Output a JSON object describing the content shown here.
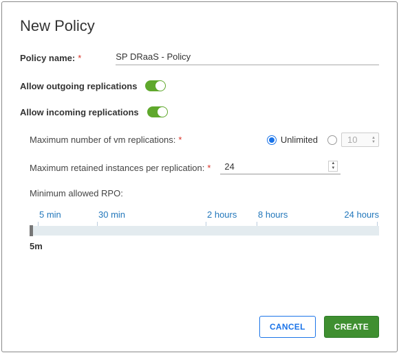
{
  "title": "New Policy",
  "policyName": {
    "label": "Policy name:",
    "required": "*",
    "value": "SP DRaaS - Policy"
  },
  "toggles": {
    "outgoing": {
      "label": "Allow outgoing replications",
      "on": true
    },
    "incoming": {
      "label": "Allow incoming replications",
      "on": true
    }
  },
  "maxVm": {
    "label": "Maximum number of vm replications:",
    "required": "*",
    "options": {
      "unlimited": "Unlimited",
      "custom": "10"
    }
  },
  "maxInstances": {
    "label": "Maximum retained instances per replication:",
    "required": "*",
    "value": "24"
  },
  "rpo": {
    "label": "Minimum allowed RPO:",
    "ticks": [
      "5 min",
      "30 min",
      "2 hours",
      "8 hours",
      "24 hours"
    ],
    "current": "5m"
  },
  "buttons": {
    "cancel": "Cancel",
    "create": "Create"
  }
}
